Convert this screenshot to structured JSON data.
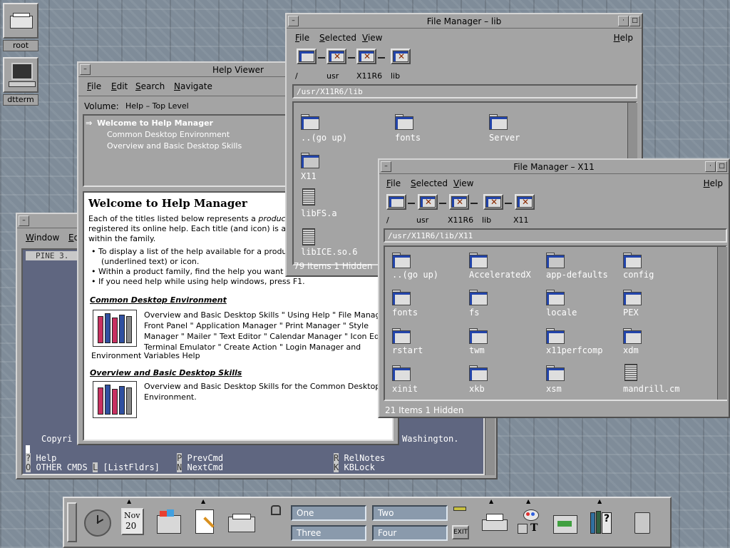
{
  "desktop": {
    "icons": [
      {
        "label": "root",
        "icon": "mail-tray-icon"
      },
      {
        "label": "dtterm",
        "icon": "terminal-computer-icon"
      }
    ]
  },
  "terminal": {
    "menu": [
      "Window",
      "Ed"
    ],
    "pine_label": "PINE 3.",
    "copyright_left": "Copyri",
    "copyright_right": "Washington.",
    "cmds": {
      "k1": "?",
      "v1": "Help",
      "k2": "O",
      "v2": "OTHER CMDS",
      "k3": "L",
      "v3": "[ListFldrs]",
      "k4": "P",
      "v4": "PrevCmd",
      "k5": "N",
      "v5": "NextCmd",
      "k6": "R",
      "v6": "RelNotes",
      "k7": "K",
      "v7": "KBLock"
    }
  },
  "help_viewer": {
    "title": "Help Viewer",
    "menu": [
      "File",
      "Edit",
      "Search",
      "Navigate"
    ],
    "volume_label": "Volume:",
    "volume_value": "Help – Top Level",
    "topics": [
      {
        "marker": "⇒",
        "text": "Welcome to Help Manager"
      },
      {
        "text": "Common Desktop Environment"
      },
      {
        "text": "Overview and Basic Desktop Skills"
      }
    ],
    "heading": "Welcome to Help Manager",
    "intro_1": "Each of the titles listed below represents a ",
    "intro_em": "product family",
    "intro_2": " registered its online help. Each title (and icon) is a hype",
    "intro_3": "within the family.",
    "bullets": [
      "To display a list of the help available for a product fa",
      "(underlined text) or icon.",
      "Within a product family, find the help you want to view",
      "If you need help while using help windows, press F1."
    ],
    "section1_title": "Common Desktop Environment",
    "section1_text_a": "Overview and Basic Desktop Skills \" Using Help \" File Manager \"",
    "section1_text_b": "Front Panel \" Application Manager \" Print Manager \" Style",
    "section1_text_c": "Manager \" Mailer \" Text Editor \" Calendar Manager \" Icon Editor \"",
    "section1_text_d": "Terminal Emulator \" Create Action \" Login Manager and",
    "section1_text_e": "Environment Variables Help",
    "section2_title": "Overview and Basic Desktop Skills",
    "section2_text_a": "Overview and Basic Desktop Skills for the Common Desktop",
    "section2_text_b": "Environment."
  },
  "fm_lib": {
    "title": "File Manager – lib",
    "menu": [
      "File",
      "Selected",
      "View"
    ],
    "help": "Help",
    "path_labels": [
      "/",
      "usr",
      "X11R6",
      "lib"
    ],
    "path_field": "/usr/X11R6/lib",
    "files": [
      {
        "name": "..(go up)",
        "type": "up"
      },
      {
        "name": "fonts",
        "type": "folder"
      },
      {
        "name": "Server",
        "type": "folder"
      },
      {
        "name": "X11",
        "type": "xfolder"
      },
      {
        "name": "libFS.a",
        "type": "doc"
      },
      {
        "name": "libICE.so.6",
        "type": "doc"
      }
    ],
    "status": "79 Items 1 Hidden"
  },
  "fm_x11": {
    "title": "File Manager – X11",
    "menu": [
      "File",
      "Selected",
      "View"
    ],
    "help": "Help",
    "path_labels": [
      "/",
      "usr",
      "X11R6",
      "lib",
      "X11"
    ],
    "path_field": "/usr/X11R6/lib/X11",
    "files": [
      {
        "name": "..(go up)",
        "type": "up"
      },
      {
        "name": "AcceleratedX",
        "type": "folder"
      },
      {
        "name": "app-defaults",
        "type": "xfolder"
      },
      {
        "name": "config",
        "type": "folder"
      },
      {
        "name": "fonts",
        "type": "folder"
      },
      {
        "name": "fs",
        "type": "folder"
      },
      {
        "name": "locale",
        "type": "folder"
      },
      {
        "name": "PEX",
        "type": "folder"
      },
      {
        "name": "rstart",
        "type": "folder"
      },
      {
        "name": "twm",
        "type": "folder"
      },
      {
        "name": "x11perfcomp",
        "type": "folder"
      },
      {
        "name": "xdm",
        "type": "folder"
      },
      {
        "name": "xinit",
        "type": "folder"
      },
      {
        "name": "xkb",
        "type": "folder"
      },
      {
        "name": "xsm",
        "type": "folder"
      },
      {
        "name": "mandrill.cm",
        "type": "doc"
      }
    ],
    "status": "21 Items 1 Hidden"
  },
  "front_panel": {
    "calendar_month": "Nov",
    "calendar_day": "20",
    "workspaces": [
      "One",
      "Two",
      "Three",
      "Four"
    ],
    "exit_label": "EXIT"
  }
}
